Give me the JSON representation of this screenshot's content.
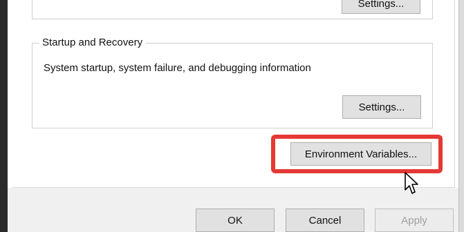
{
  "previous_group": {
    "button_label": "Settings..."
  },
  "startup_recovery": {
    "title": "Startup and Recovery",
    "description": "System startup, system failure, and debugging information",
    "settings_label": "Settings..."
  },
  "environment_variables_label": "Environment Variables...",
  "dialog_buttons": {
    "ok": "OK",
    "cancel": "Cancel",
    "apply": "Apply"
  },
  "colors": {
    "highlight": "#e53935",
    "button_bg": "#e1e1e1"
  },
  "icons": {
    "cursor": "mouse-pointer-icon"
  }
}
